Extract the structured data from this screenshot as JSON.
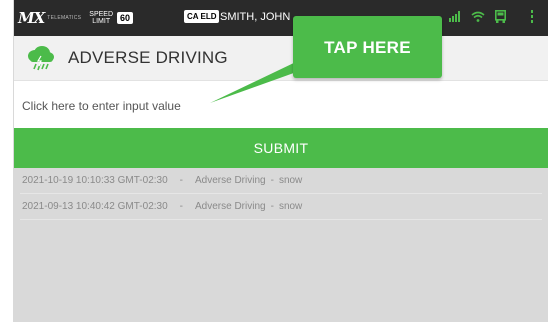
{
  "status_bar": {
    "brand_logo": "MX",
    "brand_sub": "TELEMATICS",
    "speed_label_line1": "SPEED",
    "speed_label_line2": "LIMIT",
    "speed_value": "60",
    "eld_badge": "CA ELD",
    "driver_name": "SMITH, JOHN",
    "icons": [
      "signal-icon",
      "wifi-icon",
      "truck-icon",
      "more-vert-icon"
    ]
  },
  "header": {
    "icon": "storm-cloud-icon",
    "title": "ADVERSE DRIVING"
  },
  "input": {
    "placeholder": "Click here to enter input value",
    "value": ""
  },
  "submit_label": "SUBMIT",
  "entries": [
    {
      "timestamp": "2021-10-19 10:10:33 GMT-02:30",
      "type": "Adverse Driving",
      "reason": "snow"
    },
    {
      "timestamp": "2021-09-13 10:40:42 GMT-02:30",
      "type": "Adverse Driving",
      "reason": "snow"
    }
  ],
  "callout": {
    "label": "TAP HERE"
  },
  "colors": {
    "accent_green": "#4cbb4a",
    "status_bar": "#2a2a2a",
    "header_bg": "#f1f1f1",
    "list_bg": "#d9d9d9"
  }
}
